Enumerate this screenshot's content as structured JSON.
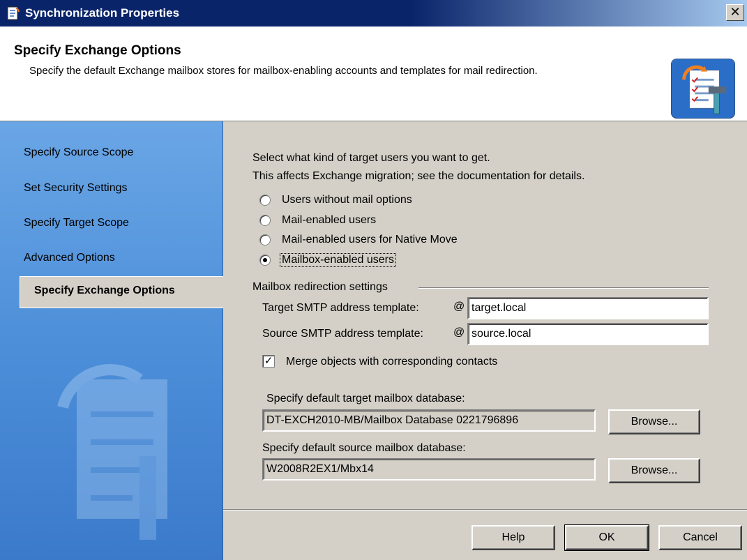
{
  "window": {
    "title": "Synchronization Properties",
    "close_glyph": "✕"
  },
  "header": {
    "title": "Specify Exchange Options",
    "description": "Specify the default Exchange mailbox stores for mailbox-enabling accounts and templates for mail redirection."
  },
  "sidebar": {
    "items": [
      {
        "label": "Specify Source Scope"
      },
      {
        "label": "Set Security Settings"
      },
      {
        "label": "Specify Target Scope"
      },
      {
        "label": "Advanced Options"
      },
      {
        "label": "Specify Exchange Options"
      }
    ],
    "active_index": 4
  },
  "main": {
    "intro_line1": "Select what kind of target users you want to get.",
    "intro_line2": "This affects Exchange migration; see the documentation for details.",
    "radio_options": [
      {
        "label": "Users without mail options",
        "checked": false
      },
      {
        "label": "Mail-enabled users",
        "checked": false
      },
      {
        "label": "Mail-enabled users for Native Move",
        "checked": false
      },
      {
        "label": "Mailbox-enabled users",
        "checked": true
      }
    ],
    "redirection_group": "Mailbox redirection settings",
    "target_smtp_label": "Target SMTP address template:",
    "target_smtp_at": "@",
    "target_smtp_value": "target.local",
    "source_smtp_label": "Source SMTP address template:",
    "source_smtp_at": "@",
    "source_smtp_value": "source.local",
    "merge_checkbox_label": "Merge objects with corresponding contacts",
    "merge_checked": true,
    "target_db_label": "Specify default target mailbox database:",
    "target_db_value": "DT-EXCH2010-MB/Mailbox Database 0221796896",
    "source_db_label": "Specify default source mailbox database:",
    "source_db_value": "W2008R2EX1/Mbx14",
    "browse_label": "Browse..."
  },
  "footer": {
    "help_label": "Help",
    "ok_label": "OK",
    "cancel_label": "Cancel"
  },
  "colors": {
    "title_bar": "#0a246a",
    "sidebar": "#4d8fd9",
    "dialog_face": "#d4d0c8"
  }
}
